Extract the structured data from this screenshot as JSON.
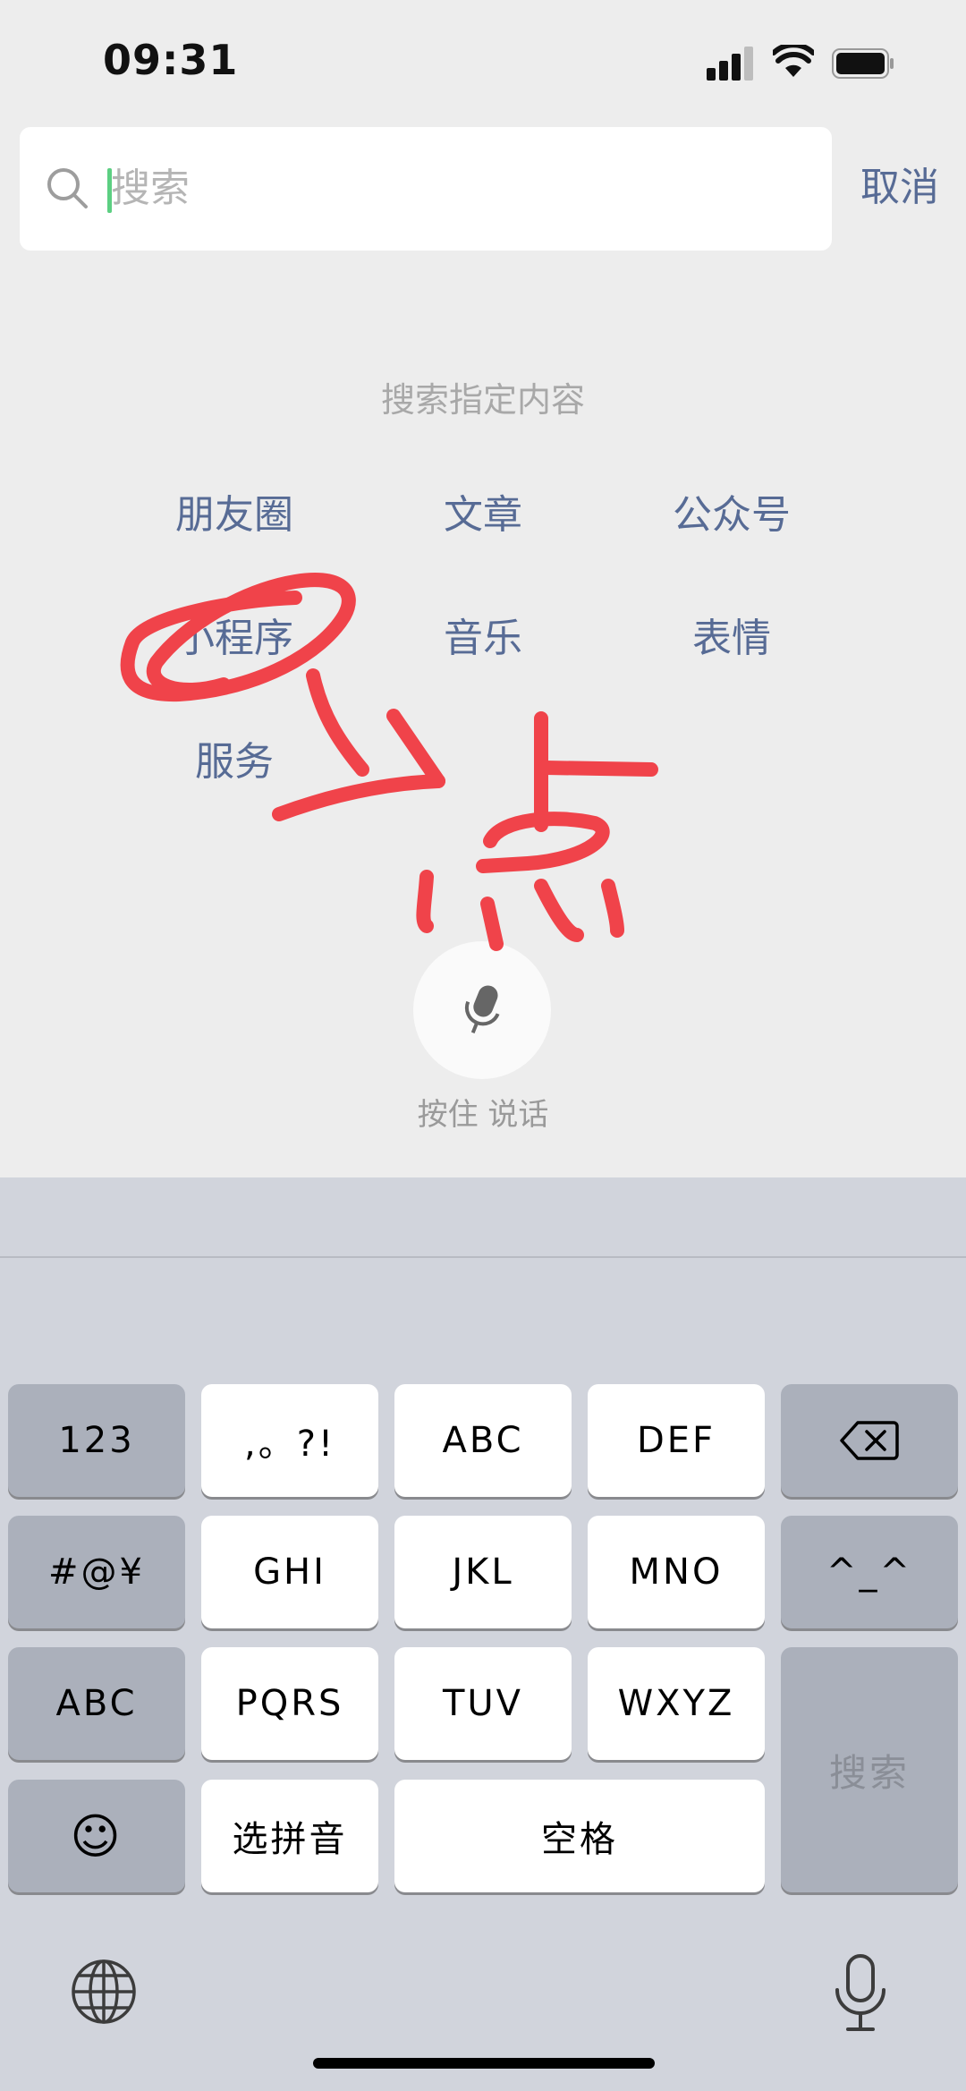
{
  "status_bar": {
    "time": "09:31"
  },
  "search": {
    "placeholder": "搜索",
    "cancel_label": "取消"
  },
  "section_title": "搜索指定内容",
  "categories": {
    "moments": "朋友圈",
    "articles": "文章",
    "official_accounts": "公众号",
    "mini_programs": "小程序",
    "music": "音乐",
    "stickers": "表情",
    "services": "服务"
  },
  "voice": {
    "label": "按住 说话",
    "icon": "microphone-icon"
  },
  "keyboard": {
    "k123": "123",
    "punct": ",。?!",
    "abc": "ABC",
    "def": "DEF",
    "symbols": "#@¥",
    "ghi": "GHI",
    "jkl": "JKL",
    "mno": "MNO",
    "kaomoji": "^_^",
    "abc_switch": "ABC",
    "pqrs": "PQRS",
    "tuv": "TUV",
    "wxyz": "WXYZ",
    "search": "搜索",
    "select_pinyin": "选拼音",
    "space": "空格",
    "emoji": "☺"
  },
  "annotation": {
    "color": "#f0434a",
    "handwritten_text": "点"
  }
}
